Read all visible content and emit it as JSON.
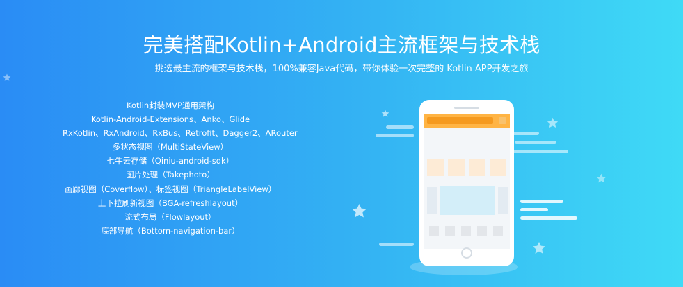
{
  "banner": {
    "title": "完美搭配Kotlin+Android主流框架与技术栈",
    "subtitle": "挑选最主流的框架与技术栈，100%兼容Java代码，带你体验一次完整的 Kotlin APP开发之旅",
    "features": [
      "Kotlin封装MVP通用架构",
      "Kotlin-Android-Extensions、Anko、Glide",
      "RxKotlin、RxAndroid、RxBus、Retrofit、Dagger2、ARouter",
      "多状态视图（MultiStateView）",
      "七牛云存储（Qiniu-android-sdk）",
      "图片处理（Takephoto）",
      "画廊视图（Coverflow）、标签视图（TriangleLabelView）",
      "上下拉刷新视图（BGA-refreshlayout）",
      "流式布局（Flowlayout）",
      "底部导航（Bottom-navigation-bar）"
    ]
  },
  "colors": {
    "gradient_start": "#2a8cf5",
    "gradient_end": "#3fdaf6",
    "phone_header": "#ffb444",
    "phone_tile": "#fdebd6"
  },
  "illustration": {
    "icons": [
      "phone-illustration",
      "star-icon"
    ]
  }
}
